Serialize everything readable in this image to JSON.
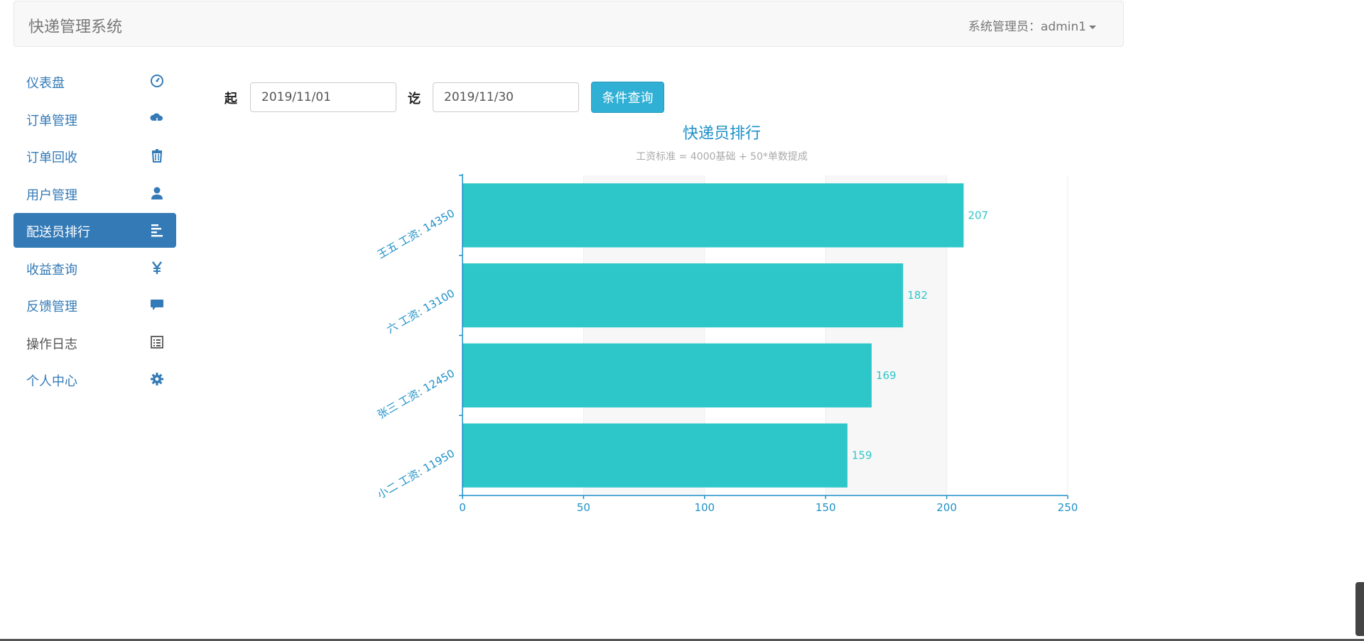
{
  "header": {
    "brand": "快递管理系统",
    "user_menu": "系统管理员：admin1"
  },
  "sidebar": {
    "items": [
      {
        "label": "仪表盘",
        "icon": "dashboard-icon"
      },
      {
        "label": "订单管理",
        "icon": "cloud-download-icon"
      },
      {
        "label": "订单回收",
        "icon": "trash-icon"
      },
      {
        "label": "用户管理",
        "icon": "user-icon"
      },
      {
        "label": "配送员排行",
        "icon": "align-left-icon"
      },
      {
        "label": "收益查询",
        "icon": "yen-icon"
      },
      {
        "label": "反馈管理",
        "icon": "comment-icon"
      },
      {
        "label": "操作日志",
        "icon": "list-alt-icon"
      },
      {
        "label": "个人中心",
        "icon": "cog-icon"
      }
    ],
    "active_index": 4
  },
  "query": {
    "start_label": "起",
    "start_value": "2019/11/01",
    "end_label": "讫",
    "end_value": "2019/11/30",
    "button_label": "条件查询"
  },
  "colors": {
    "accent": "#337ab7",
    "bar": "#2ec7c9",
    "axis": "#1e90c8",
    "button": "#31b0d5"
  },
  "chart_data": {
    "type": "bar",
    "orientation": "horizontal",
    "title": "快递员排行",
    "subtitle": "工资标准 = 4000基础 + 50*单数提成",
    "categories": [
      "王五 工资: 14350",
      "六 工资: 13100",
      "张三 工资: 12450",
      "小二 工资: 11950"
    ],
    "values": [
      207,
      182,
      169,
      159
    ],
    "xlim": [
      0,
      250
    ],
    "xticks": [
      0,
      50,
      100,
      150,
      200,
      250
    ],
    "grid": "alternating-bands"
  }
}
